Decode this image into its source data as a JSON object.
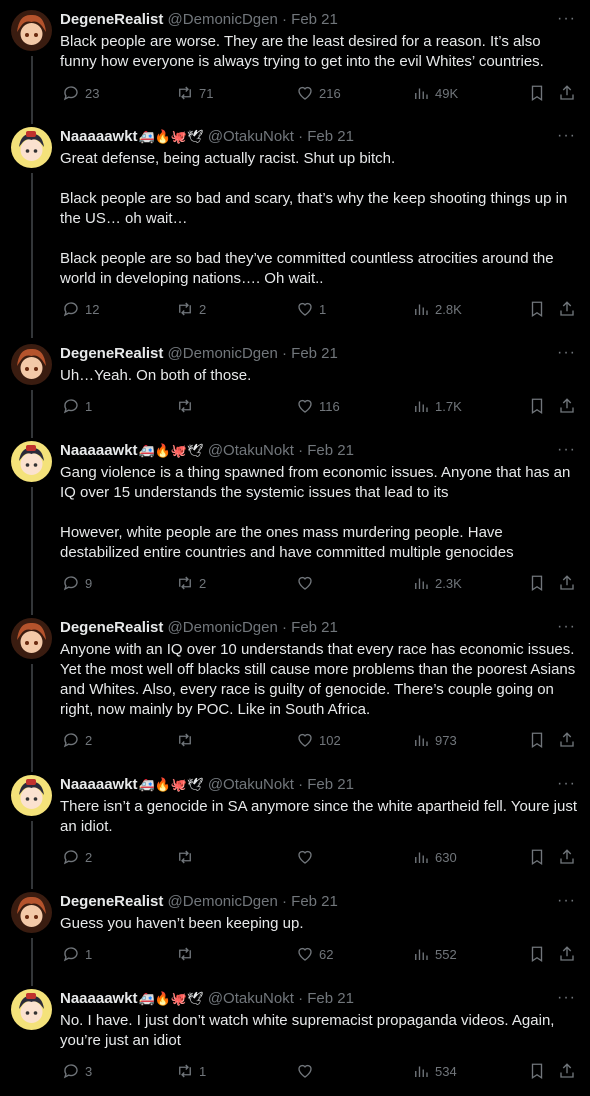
{
  "tweets": [
    {
      "author": "DegeneRealist",
      "handle": "@DemonicDgen",
      "time": "Feb 21",
      "emoji": "",
      "text": "Black people are worse. They are the least desired for a reason. It’s also funny how everyone is always trying to get into the evil Whites’ countries.",
      "replies": "23",
      "reposts": "71",
      "likes": "216",
      "views": "49K"
    },
    {
      "author": "Naaaaawkt",
      "handle": "@OtakuNokt",
      "time": "Feb 21",
      "emoji": "🚑🔥🐙🕊",
      "text": "Great defense, being actually racist. Shut up bitch.\n\nBlack people are so bad and scary, that’s why the keep shooting things up in the US… oh wait…\n\nBlack people are so bad they’ve committed countless atrocities around the world in developing nations…. Oh wait..",
      "replies": "12",
      "reposts": "2",
      "likes": "1",
      "views": "2.8K"
    },
    {
      "author": "DegeneRealist",
      "handle": "@DemonicDgen",
      "time": "Feb 21",
      "emoji": "",
      "text": "Uh…Yeah. On both of those.",
      "replies": "1",
      "reposts": "",
      "likes": "116",
      "views": "1.7K"
    },
    {
      "author": "Naaaaawkt",
      "handle": "@OtakuNokt",
      "time": "Feb 21",
      "emoji": "🚑🔥🐙🕊",
      "text": "Gang violence is a thing spawned from economic issues. Anyone that has an IQ over 15 understands the systemic issues that lead to its\n\nHowever, white people are the ones mass murdering people. Have destabilized entire countries and have committed multiple genocides",
      "replies": "9",
      "reposts": "2",
      "likes": "",
      "views": "2.3K"
    },
    {
      "author": "DegeneRealist",
      "handle": "@DemonicDgen",
      "time": "Feb 21",
      "emoji": "",
      "text": "Anyone with an IQ over 10 understands that every race has economic issues. Yet the most well off blacks still cause more problems than the poorest Asians and Whites. Also, every race is guilty of genocide. There’s couple going on right, now mainly by POC. Like in South Africa.",
      "replies": "2",
      "reposts": "",
      "likes": "102",
      "views": "973"
    },
    {
      "author": "Naaaaawkt",
      "handle": "@OtakuNokt",
      "time": "Feb 21",
      "emoji": "🚑🔥🐙🕊",
      "text": "There isn’t a genocide in SA anymore since the white apartheid fell. Youre just an idiot.",
      "replies": "2",
      "reposts": "",
      "likes": "",
      "views": "630"
    },
    {
      "author": "DegeneRealist",
      "handle": "@DemonicDgen",
      "time": "Feb 21",
      "emoji": "",
      "text": "Guess you haven’t been keeping up.",
      "replies": "1",
      "reposts": "",
      "likes": "62",
      "views": "552"
    },
    {
      "author": "Naaaaawkt",
      "handle": "@OtakuNokt",
      "time": "Feb 21",
      "emoji": "🚑🔥🐙🕊",
      "text": "No. I have. I just don’t watch white supremacist propaganda videos. Again, you’re just an idiot",
      "replies": "3",
      "reposts": "1",
      "likes": "",
      "views": "534"
    }
  ]
}
